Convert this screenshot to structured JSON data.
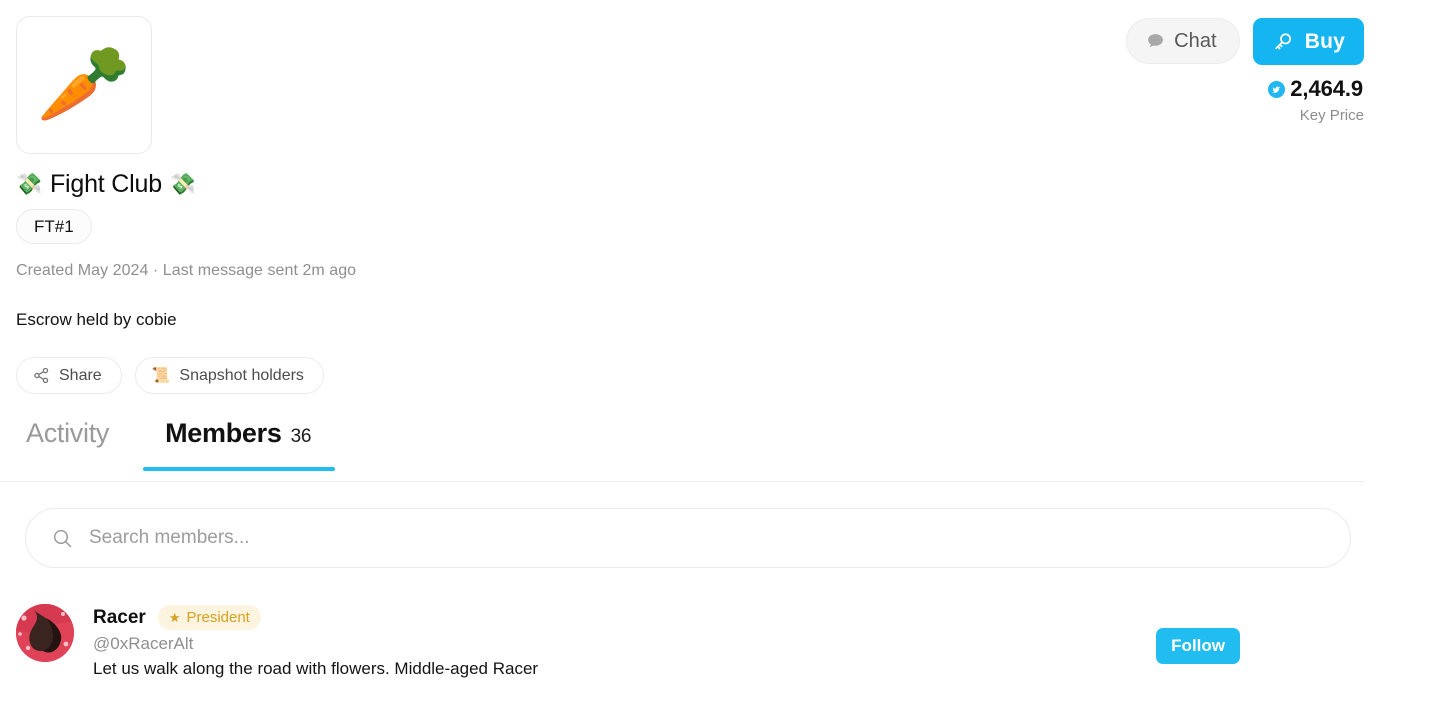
{
  "header": {
    "thumbnail_emoji": "🥕",
    "thumbnail_name": "carrot-emoji",
    "title_emoji_left": "💸",
    "title_text": "Fight Club",
    "title_emoji_right": "💸",
    "ticker_badge": "FT#1",
    "meta": "Created May 2024 · Last message sent 2m ago",
    "escrow": "Escrow held by cobie"
  },
  "top_actions": {
    "chat_label": "Chat",
    "buy_label": "Buy",
    "price_value": "2,464.9",
    "price_caption": "Key Price"
  },
  "pills": [
    {
      "label": "Share",
      "icon": "share-icon"
    },
    {
      "label": "Snapshot holders",
      "icon": "scroll-icon",
      "glyph": "📜"
    }
  ],
  "tabs": [
    {
      "label": "Activity",
      "count": "",
      "active": false
    },
    {
      "label": "Members",
      "count": "36",
      "active": true
    }
  ],
  "search": {
    "placeholder": "Search members...",
    "value": ""
  },
  "members": [
    {
      "name": "Racer",
      "role": "President",
      "role_star": "★",
      "handle": "@0xRacerAlt",
      "bio": "Let us walk along the road with flowers. Middle-aged Racer",
      "follow_label": "Follow"
    }
  ],
  "colors": {
    "accent": "#22bdf0",
    "buy": "#14b5f0",
    "role_text": "#d6a023",
    "role_bg": "#fdf4df",
    "muted": "#8f8f8f"
  }
}
